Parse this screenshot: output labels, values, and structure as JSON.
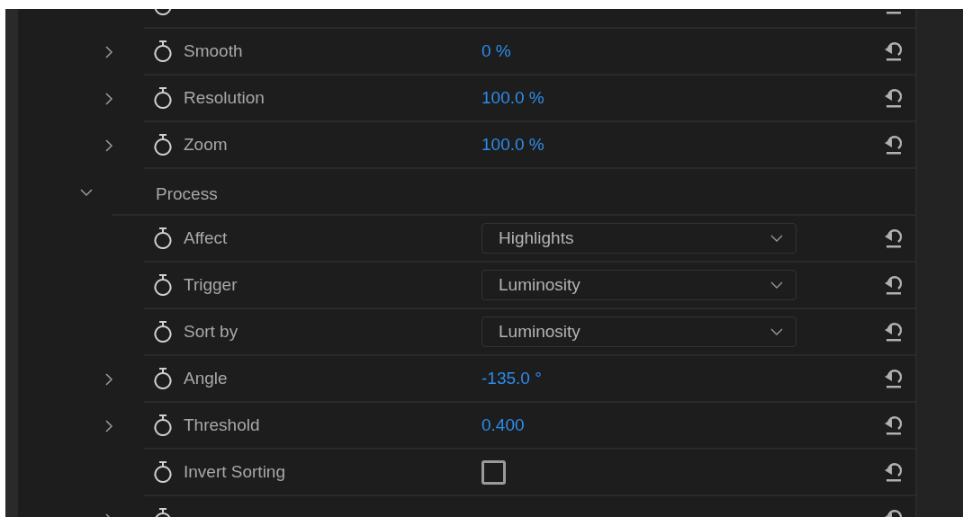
{
  "rows": [
    {
      "kind": "stub",
      "expandable": false
    },
    {
      "kind": "number",
      "label": "Smooth",
      "value": "0 %",
      "expandable": true
    },
    {
      "kind": "number",
      "label": "Resolution",
      "value": "100.0 %",
      "expandable": true
    },
    {
      "kind": "number",
      "label": "Zoom",
      "value": "100.0 %",
      "expandable": true
    },
    {
      "kind": "group",
      "label": "Process",
      "expanded": true
    },
    {
      "kind": "dropdown",
      "label": "Affect",
      "value": "Highlights",
      "expandable": false
    },
    {
      "kind": "dropdown",
      "label": "Trigger",
      "value": "Luminosity",
      "expandable": false
    },
    {
      "kind": "dropdown",
      "label": "Sort by",
      "value": "Luminosity",
      "expandable": false
    },
    {
      "kind": "number",
      "label": "Angle",
      "value": "-135.0 °",
      "expandable": true
    },
    {
      "kind": "number",
      "label": "Threshold",
      "value": "0.400",
      "expandable": true
    },
    {
      "kind": "checkbox",
      "label": "Invert Sorting",
      "checked": false,
      "expandable": false
    },
    {
      "kind": "stub",
      "expandable": true
    }
  ]
}
